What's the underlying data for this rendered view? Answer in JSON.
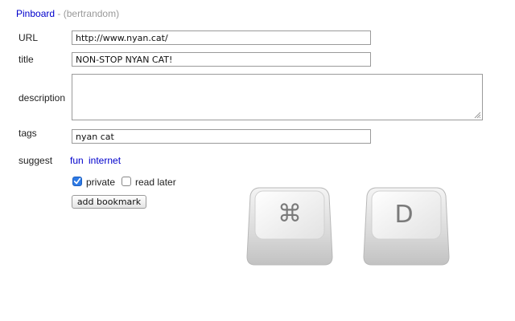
{
  "header": {
    "brand": "Pinboard",
    "separator": " - ",
    "user": "(bertrandom)"
  },
  "form": {
    "url_label": "URL",
    "url_value": "http://www.nyan.cat/",
    "title_label": "title",
    "title_value": "NON-STOP NYAN CAT!",
    "description_label": "description",
    "description_value": "",
    "tags_label": "tags",
    "tags_value": "nyan cat",
    "suggest_label": "suggest",
    "suggestions": [
      "fun",
      "internet"
    ],
    "private_label": "private",
    "private_checked": true,
    "read_later_label": "read later",
    "read_later_checked": false,
    "submit_label": "add bookmark"
  },
  "keys": {
    "command_glyph": "⌘",
    "letter": "D"
  },
  "colors": {
    "link": "#0000cc",
    "muted": "#999999",
    "checkbox_accent": "#2d7ae6"
  }
}
